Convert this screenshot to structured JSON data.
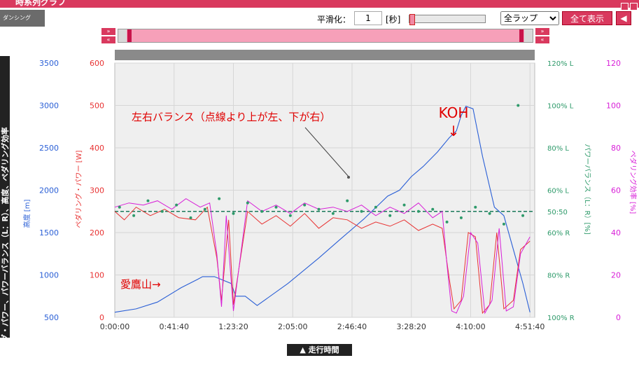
{
  "window": {
    "title": "時系列グラフ"
  },
  "logo": {
    "text": "ダンシング"
  },
  "toolbar": {
    "smooth_label": "平滑化：",
    "smooth_value": "1",
    "smooth_unit": "[秒]",
    "lap_selected": "全ラップ",
    "show_all_label": "全て表示",
    "back_icon": "arrow-left-icon"
  },
  "nav": {
    "forward": "»",
    "back": "«"
  },
  "side_tab": {
    "label": "▼ペダリング・パワー、パワーバランス（L：R）、高度、ペダリング効率"
  },
  "bottom_tab": {
    "label": "▲ 走行時間"
  },
  "colors": {
    "altitude": "#2a5fd6",
    "power": "#e83232",
    "balance": "#2e9a6a",
    "efficiency": "#d81fd8",
    "accent": "#d9395e"
  },
  "chart_data": {
    "type": "line",
    "x_unit": "seconds",
    "x_ticks": [
      "0:00:00",
      "0:41:40",
      "1:23:20",
      "2:05:00",
      "2:46:40",
      "3:28:20",
      "4:10:00",
      "4:51:40"
    ],
    "xlim": [
      0,
      17700
    ],
    "axes": {
      "altitude": {
        "label": "高度 [m]",
        "lim": [
          500,
          3500
        ],
        "ticks": [
          "3500",
          "3000",
          "2500",
          "2000",
          "1500",
          "1000",
          "500"
        ]
      },
      "power": {
        "label": "ペダリング・パワー [W]",
        "lim": [
          0,
          600
        ],
        "ticks": [
          "600",
          "500",
          "400",
          "300",
          "200",
          "100",
          "0"
        ]
      },
      "balance": {
        "label": "パワーバランス（L：R）[%]",
        "ticks": [
          "120% L",
          "100% L",
          "80% L",
          "60% L",
          "50:50",
          "60% R",
          "80% R",
          "100% R"
        ]
      },
      "efficiency": {
        "label": "ペダリング効率 [%]",
        "lim": [
          0,
          120
        ],
        "ticks": [
          "120",
          "100",
          "80",
          "60",
          "40",
          "20",
          "0"
        ]
      }
    },
    "series": [
      {
        "name": "高度",
        "axis": "altitude",
        "x": [
          0,
          900,
          1800,
          2800,
          3500,
          3700,
          4200,
          4900,
          5100,
          5500,
          6000,
          7300,
          8600,
          9500,
          10500,
          11500,
          12000,
          12500,
          13000,
          13600,
          14100,
          14400,
          14600,
          14800,
          15100,
          15500,
          16000,
          16400,
          16800,
          17200,
          17500
        ],
        "y": [
          560,
          600,
          680,
          850,
          950,
          980,
          980,
          900,
          750,
          750,
          640,
          900,
          1200,
          1420,
          1660,
          1930,
          2000,
          2160,
          2280,
          2450,
          2620,
          2700,
          2880,
          2990,
          2960,
          2400,
          1800,
          1700,
          1300,
          900,
          560
        ]
      },
      {
        "name": "ペダリング・パワー",
        "axis": "power",
        "x": [
          0,
          400,
          900,
          1500,
          2100,
          2700,
          3400,
          3900,
          4300,
          4500,
          4800,
          5000,
          5600,
          6200,
          6800,
          7400,
          8000,
          8600,
          9200,
          9800,
          10400,
          11000,
          11600,
          12200,
          12800,
          13400,
          13800,
          14000,
          14100,
          14300,
          14600,
          14900,
          15200,
          15500,
          15800,
          16100,
          16400,
          16800,
          17100,
          17500
        ],
        "y": [
          250,
          230,
          260,
          240,
          255,
          235,
          230,
          260,
          140,
          40,
          230,
          30,
          250,
          220,
          240,
          215,
          245,
          210,
          235,
          230,
          210,
          225,
          215,
          230,
          205,
          220,
          210,
          130,
          90,
          20,
          40,
          200,
          190,
          10,
          30,
          200,
          20,
          40,
          160,
          180
        ]
      },
      {
        "name": "ペダリング効率",
        "axis": "efficiency",
        "x": [
          0,
          600,
          1200,
          1800,
          2400,
          3000,
          3600,
          4000,
          4300,
          4500,
          4700,
          5000,
          5600,
          6200,
          6800,
          7400,
          8000,
          8600,
          9200,
          9800,
          10400,
          11000,
          11600,
          12200,
          12800,
          13400,
          13800,
          14000,
          14200,
          14400,
          14700,
          15000,
          15300,
          15600,
          15900,
          16200,
          16500,
          16800,
          17100,
          17500
        ],
        "y": [
          52,
          54,
          53,
          55,
          51,
          56,
          52,
          54,
          30,
          5,
          48,
          3,
          55,
          50,
          53,
          49,
          54,
          51,
          52,
          50,
          53,
          48,
          52,
          49,
          54,
          47,
          50,
          25,
          3,
          2,
          10,
          40,
          35,
          2,
          8,
          42,
          3,
          5,
          30,
          38
        ]
      },
      {
        "name": "パワーバランス",
        "axis": "balance",
        "points": "scatter",
        "x": [
          200,
          800,
          1400,
          2000,
          2600,
          3200,
          3800,
          4400,
          5000,
          5600,
          6200,
          6800,
          7400,
          8000,
          8600,
          9200,
          9800,
          10400,
          11000,
          11600,
          12200,
          12800,
          13400,
          14000,
          14600,
          15200,
          15800,
          16400,
          17000,
          17200
        ],
        "y": [
          52,
          48,
          55,
          50,
          53,
          47,
          51,
          56,
          49,
          54,
          50,
          52,
          48,
          53,
          51,
          49,
          55,
          50,
          52,
          48,
          53,
          50,
          51,
          45,
          47,
          52,
          49,
          44,
          100,
          48
        ]
      }
    ],
    "reference_line": {
      "axis": "balance",
      "value": "50:50"
    },
    "annotations": [
      "左右バランス（点線より上が左、下が右）",
      "KOH",
      "↓",
      "愛鷹山→"
    ],
    "grid": true
  }
}
